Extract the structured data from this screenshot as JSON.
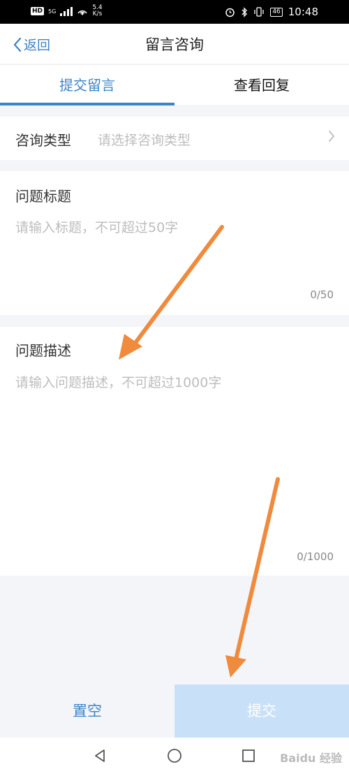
{
  "status_bar": {
    "hd": "HD",
    "network": "5G",
    "speed_value": "5.4",
    "speed_unit": "K/s",
    "battery": "46",
    "time": "10:48"
  },
  "header": {
    "back_label": "返回",
    "title": "留言咨询"
  },
  "tabs": [
    {
      "label": "提交留言",
      "active": true
    },
    {
      "label": "查看回复",
      "active": false
    }
  ],
  "form": {
    "type": {
      "label": "咨询类型",
      "placeholder": "请选择咨询类型"
    },
    "title": {
      "label": "问题标题",
      "placeholder": "请输入标题，不可超过50字",
      "counter": "0/50"
    },
    "description": {
      "label": "问题描述",
      "placeholder": "请输入问题描述，不可超过1000字",
      "counter": "0/1000"
    }
  },
  "actions": {
    "clear_label": "置空",
    "submit_label": "提交"
  },
  "watermark": "Baidu 经验",
  "colors": {
    "accent": "#3d84c7",
    "submit_bg": "#c9e1f8",
    "arrow": "#f08a3c"
  }
}
